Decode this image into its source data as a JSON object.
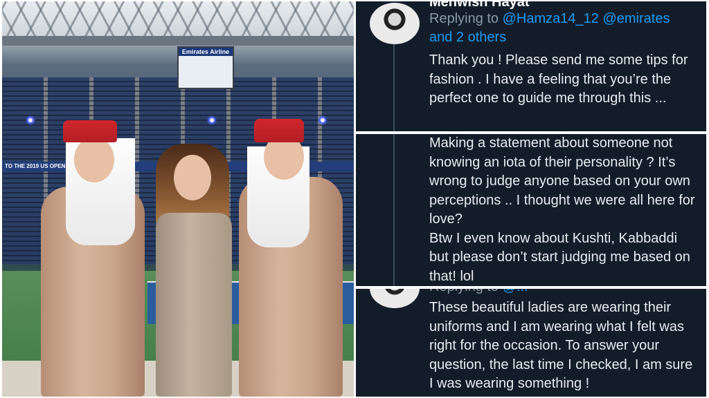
{
  "photo": {
    "scoreboard_label": "Emirates Airline",
    "banner_text": "TO THE 2019 US OPEN"
  },
  "tweets": [
    {
      "username": "Mehwish Hayat",
      "reply_prefix": "Replying to",
      "mentions": [
        "@Hamza14_12",
        "@emirates"
      ],
      "others": "and 2 others",
      "body": "Thank you ! Please send me some tips for fashion . I have a feeling that you’re the perfect one to guide me through this ..."
    },
    {
      "body_lines": [
        "Making a statement about someone not knowing an iota of their personality ? It’s wrong to judge anyone based on your own perceptions .. I thought we were all here for love?",
        "Btw I even know about Kushti,  Kabbaddi but please don’t start judging me based on that!  lol"
      ]
    },
    {
      "reply_prefix": "Replying to",
      "mention": "@...",
      "body": "These beautiful ladies are wearing their uniforms and I am wearing what I felt was right for the occasion. To answer your question, the last time I checked, I am sure I was wearing something !"
    }
  ],
  "colors": {
    "panel_bg": "#131d2a",
    "link": "#1d9bf0",
    "text": "#e7ecf0",
    "muted": "#8899a6"
  }
}
